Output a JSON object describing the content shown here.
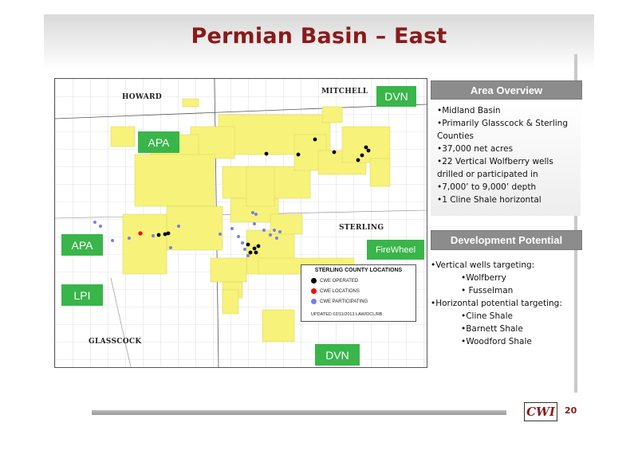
{
  "slide": {
    "title": "Permian Basin – East",
    "page_number": "20",
    "logo_text": "CWI"
  },
  "map": {
    "counties": {
      "howard": "HOWARD",
      "mitchell": "MITCHELL",
      "sterling": "STERLING",
      "glasscock": "GLASSCOCK"
    },
    "operators": {
      "dvn_top": "DVN",
      "apa_upper": "APA",
      "apa_left": "APA",
      "lpi": "LPI",
      "firewheel": "FireWheel",
      "dvn_bottom": "DVN"
    },
    "colors": {
      "acreage": "#f6f27a",
      "operator_tag": "#39b54a",
      "operated": "#000000",
      "locations": "#ff0000",
      "participating": "#7b7bf0"
    },
    "legend": {
      "title": "STERLING COUNTY LOCATIONS",
      "operated": "CWE OPERATED",
      "locations": "CWE LOCATIONS",
      "participating": "CWE PARTICIPATING",
      "updated": "UPDATED 02/11/2013 LAW/DCL/RB"
    }
  },
  "area_overview": {
    "header": "Area Overview",
    "items": [
      "•Midland Basin",
      "•Primarily Glasscock & Sterling Counties",
      "•37,000 net acres",
      "•22 Vertical Wolfberry wells drilled or participated in",
      "•7,000’ to 9,000’ depth",
      "•1 Cline Shale horizontal"
    ]
  },
  "development_potential": {
    "header": "Development Potential",
    "vertical_heading": "•Vertical wells targeting:",
    "vertical_items": [
      "•Wolfberry",
      "• Fusselman"
    ],
    "horizontal_heading": "•Horizontal potential targeting:",
    "horizontal_items": [
      "•Cline Shale",
      "•Barnett Shale",
      "•Woodford Shale"
    ]
  }
}
